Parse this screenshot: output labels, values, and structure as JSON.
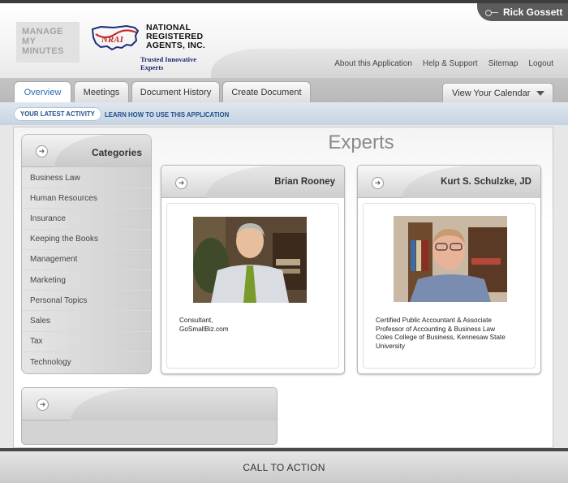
{
  "user": {
    "name": "Rick Gossett"
  },
  "brand": {
    "app_logo_lines": [
      "MANAGE",
      "MY",
      "MINUTES"
    ],
    "company_logo_mark": "NRAI",
    "company_lines": [
      "NATIONAL",
      "REGISTERED",
      "AGENTS, INC."
    ],
    "tagline": "Trusted Innovative Experts"
  },
  "utility_nav": [
    "About this Application",
    "Help & Support",
    "Sitemap",
    "Logout"
  ],
  "tabs": [
    {
      "label": "Overview",
      "active": true
    },
    {
      "label": "Meetings",
      "active": false
    },
    {
      "label": "Document History",
      "active": false
    },
    {
      "label": "Create Document",
      "active": false
    }
  ],
  "calendar_button": "View Your Calendar",
  "subnav": {
    "latest_activity": "YOUR LATEST ACTIVITY",
    "how_to": "LEARN HOW TO USE THIS APPLICATION"
  },
  "categories": {
    "title": "Categories",
    "items": [
      "Business Law",
      "Human Resources",
      "Insurance",
      "Keeping the Books",
      "Management",
      "Marketing",
      "Personal Topics",
      "Sales",
      "Tax",
      "Technology"
    ]
  },
  "experts": {
    "title": "Experts",
    "cards": [
      {
        "name": "Brian Rooney",
        "desc_lines": [
          "Consultant,",
          "GoSmallBiz.com"
        ]
      },
      {
        "name": "Kurt S. Schulzke, JD",
        "desc_lines": [
          "Certified Public Accountant & Associate",
          "Professor of Accounting & Business Law",
          "Coles College of Business, Kennesaw State",
          "University"
        ]
      }
    ]
  },
  "footer": {
    "cta": "CALL TO ACTION"
  },
  "colors": {
    "accent_blue": "#2a6bb3",
    "subnav_blue": "#1f4f8c",
    "dark_bar": "#5b5b5b"
  }
}
